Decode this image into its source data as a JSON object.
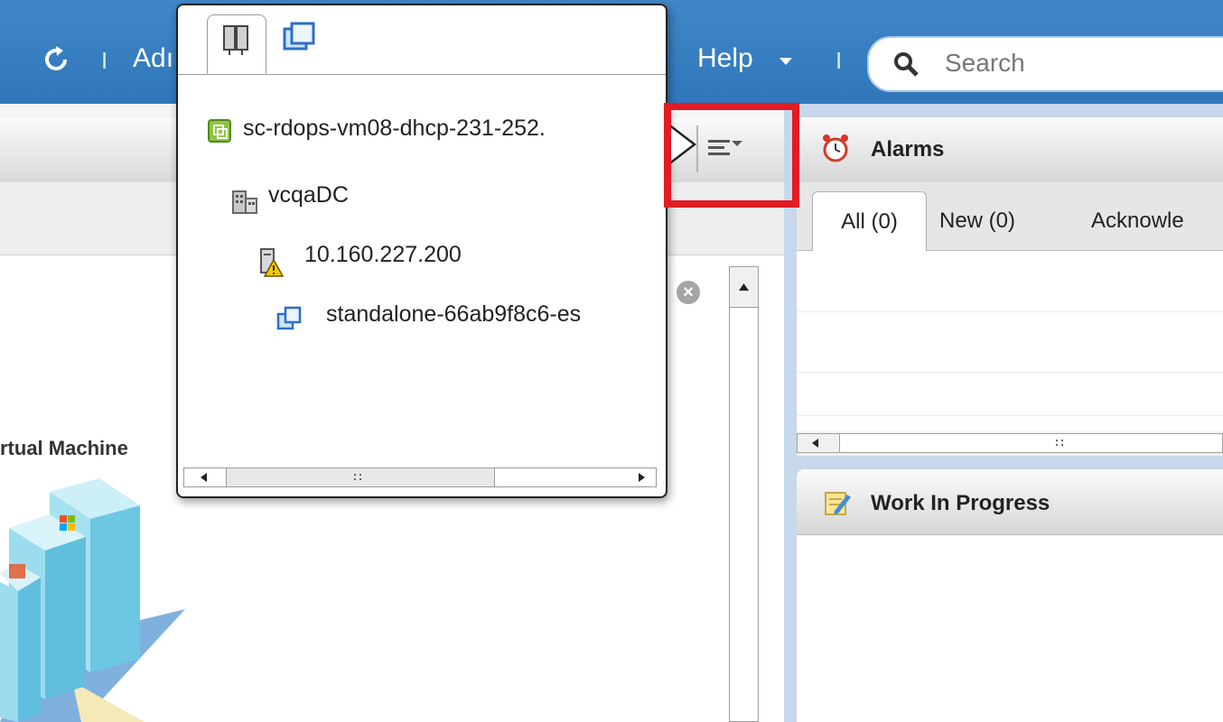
{
  "header": {
    "admin_text": "Adı",
    "help_label": "Help",
    "separator": "I",
    "search": {
      "placeholder": "Search"
    }
  },
  "left_panel": {
    "vm_label": "rtual Machine"
  },
  "popup": {
    "tree": [
      {
        "label": "sc-rdops-vm08-dhcp-231-252.",
        "icon": "vcenter-icon",
        "level": 0
      },
      {
        "label": "vcqaDC",
        "icon": "datacenter-icon",
        "level": 1
      },
      {
        "label": "10.160.227.200",
        "icon": "host-warning-icon",
        "level": 2
      },
      {
        "label": "standalone-66ab9f8c6-es",
        "icon": "resource-pool-icon",
        "level": 3
      }
    ]
  },
  "alarms": {
    "title": "Alarms",
    "tabs": [
      "All (0)",
      "New (0)",
      "Acknowle"
    ]
  },
  "wip": {
    "title": "Work In Progress"
  },
  "colors": {
    "topbar": "#2f77ba",
    "highlight": "#e31b23"
  }
}
